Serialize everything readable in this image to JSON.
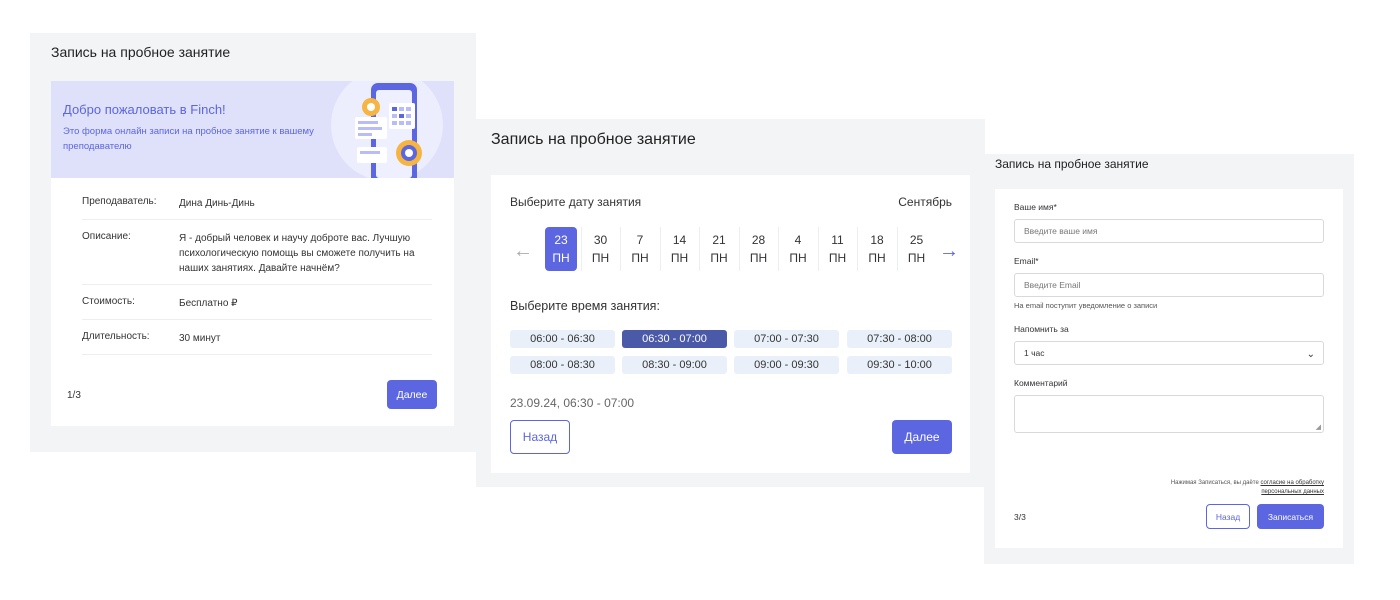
{
  "screen1": {
    "title": "Запись на пробное занятие",
    "banner": {
      "heading": "Добро пожаловать в Finch!",
      "text": "Это форма онлайн записи на пробное занятие к вашему преподавателю"
    },
    "rows": [
      {
        "label": "Преподаватель:",
        "value": "Дина Динь-Динь"
      },
      {
        "label": "Описание:",
        "value": "Я - добрый человек и научу доброте вас.  Лучшую психологическую помощь вы сможете получить на наших занятиях. Давайте начнём?"
      },
      {
        "label": "Стоимость:",
        "value": "Бесплатно ₽"
      },
      {
        "label": "Длительность:",
        "value": "30 минут"
      }
    ],
    "pager": "1/3",
    "next_label": "Далее"
  },
  "screen2": {
    "title": "Запись на пробное занятие",
    "date_label": "Выберите дату занятия",
    "month": "Сентябрь",
    "dates": [
      {
        "day": "23",
        "weekday": "ПН",
        "selected": true
      },
      {
        "day": "30",
        "weekday": "ПН",
        "selected": false
      },
      {
        "day": "7",
        "weekday": "ПН",
        "selected": false
      },
      {
        "day": "14",
        "weekday": "ПН",
        "selected": false
      },
      {
        "day": "21",
        "weekday": "ПН",
        "selected": false
      },
      {
        "day": "28",
        "weekday": "ПН",
        "selected": false
      },
      {
        "day": "4",
        "weekday": "ПН",
        "selected": false
      },
      {
        "day": "11",
        "weekday": "ПН",
        "selected": false
      },
      {
        "day": "18",
        "weekday": "ПН",
        "selected": false
      },
      {
        "day": "25",
        "weekday": "ПН",
        "selected": false
      }
    ],
    "time_label": "Выберите время занятия:",
    "slots": [
      {
        "label": "06:00 - 06:30",
        "selected": false
      },
      {
        "label": "06:30 - 07:00",
        "selected": true
      },
      {
        "label": "07:00 - 07:30",
        "selected": false
      },
      {
        "label": "07:30 - 08:00",
        "selected": false
      },
      {
        "label": "08:00 - 08:30",
        "selected": false
      },
      {
        "label": "08:30 - 09:00",
        "selected": false
      },
      {
        "label": "09:00 - 09:30",
        "selected": false
      },
      {
        "label": "09:30 - 10:00",
        "selected": false
      }
    ],
    "chosen": "23.09.24, 06:30 - 07:00",
    "back_label": "Назад",
    "next_label": "Далее"
  },
  "screen3": {
    "title": "Запись на пробное занятие",
    "name_label": "Ваше имя*",
    "name_placeholder": "Введите ваше имя",
    "email_label": "Email*",
    "email_placeholder": "Введите Email",
    "email_hint": "На email поступит уведомление о записи",
    "remind_label": "Напомнить за",
    "remind_value": "1 час",
    "comment_label": "Комментарий",
    "consent_text": "Нажимая Записаться, вы даёте",
    "consent_link": "согласие на обработку персональных данных",
    "pager": "3/3",
    "back_label": "Назад",
    "submit_label": "Записаться"
  },
  "colors": {
    "accent": "#5b66e0",
    "selected_slot": "#4b5aa8",
    "slot_bg": "#eaf0fa",
    "banner_bg": "#dfe1fb"
  },
  "icons": {
    "prev": "arrow-left-icon",
    "next": "arrow-right-icon",
    "select": "chevron-down-icon"
  }
}
